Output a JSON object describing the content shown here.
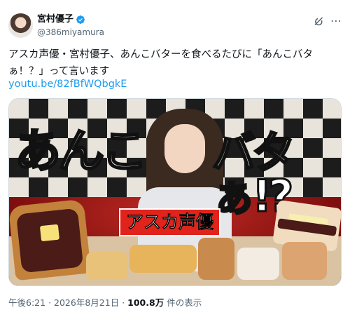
{
  "author": {
    "display_name": "宮村優子",
    "handle": "@386miyamura",
    "verified_color": "#1d9bf0"
  },
  "tweet": {
    "text": "アスカ声優・宮村優子、あんこバターを食べるたびに「あんこバタ\nぁ！？」って言います",
    "link": "youtu.be/82fBfWQbgkE"
  },
  "media": {
    "thumbnail_text_left": "あんこ",
    "thumbnail_text_right": "バタぁ!?",
    "thumbnail_tag": "アスカ声優",
    "colors": {
      "tag_red": "#e0231b",
      "sofa_red": "#c22a24",
      "anko": "#4a1b17"
    }
  },
  "meta": {
    "time": "午後6:21",
    "separator": "·",
    "date": "2026年8月21日",
    "views_count": "100.8万",
    "views_suffix": "件の表示"
  },
  "icons": {
    "grok": "grok-icon",
    "more": "more-icon",
    "verified": "verified-badge-icon"
  }
}
